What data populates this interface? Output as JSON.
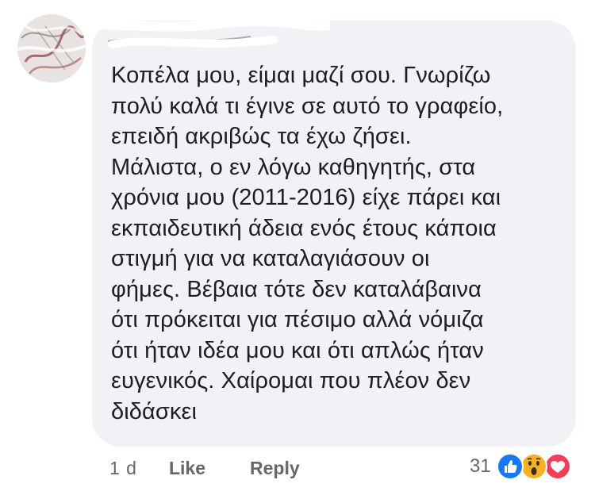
{
  "comment": {
    "author": "",
    "text": "Κοπέλα μου, είμαι μαζί σου. Γνωρίζω\nπολύ καλά τι έγινε σε αυτό το γραφείο,\nεπειδή ακριβώς τα έχω ζήσει.\nΜάλιστα, ο εν λόγω καθηγητής, στα\nχρόνια μου (2011-2016) είχε πάρει και\nεκπαιδευτική άδεια ενός έτους κάποια\nστιγμή για να καταλαγιάσουν οι\nφήμες. Βέβαια τότε δεν καταλάβαινα\nότι πρόκειται για πέσιμο αλλά νόμιζα\nότι ήταν ιδέα μου και ότι απλώς ήταν\nευγενικός. Χαίρομαι που πλέον δεν\nδιδάσκει"
  },
  "actions": {
    "timestamp": "1 d",
    "like_label": "Like",
    "reply_label": "Reply"
  },
  "reactions": {
    "count": "31",
    "icons": [
      "like-reaction-icon",
      "wow-reaction-icon",
      "love-reaction-icon"
    ],
    "colors": {
      "like": "#1877f2",
      "wow": "#f7b125",
      "love": "#f33e58"
    }
  },
  "colors": {
    "bubble": "#f0f2f5",
    "text": "#1c1e21",
    "secondary_text": "#65676b"
  }
}
